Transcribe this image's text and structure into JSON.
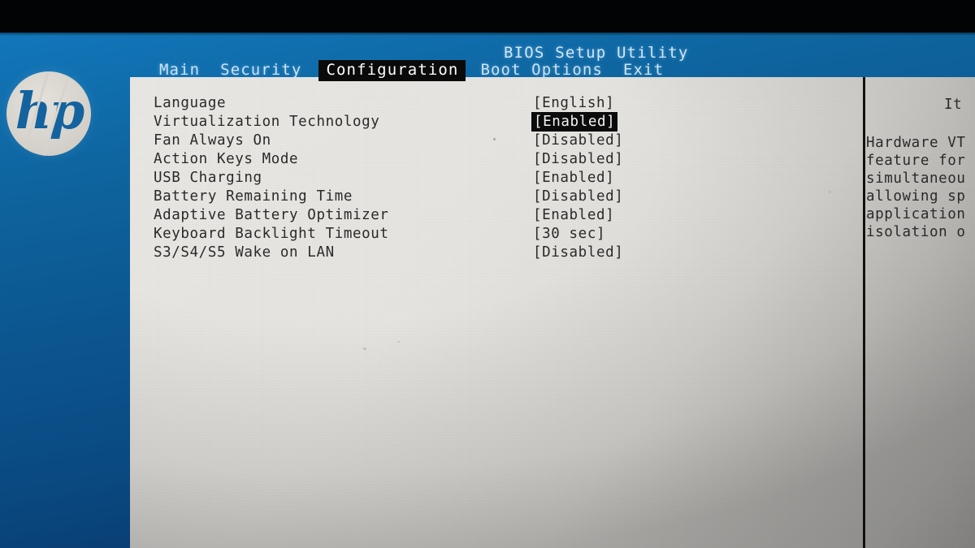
{
  "screen": {
    "utility_title": "BIOS Setup Utility",
    "brand_logo": "hp",
    "accent_blue": "#0c5690",
    "panel_gray": "#e9e7e3",
    "highlight_bg": "#0b0b0b",
    "highlight_fg": "#ffffff"
  },
  "tabs": [
    {
      "label": "Main",
      "active": false
    },
    {
      "label": "Security",
      "active": false
    },
    {
      "label": "Configuration",
      "active": true
    },
    {
      "label": "Boot Options",
      "active": false
    },
    {
      "label": "Exit",
      "active": false
    }
  ],
  "settings": [
    {
      "label": "Language",
      "value": "[English]",
      "selected": false
    },
    {
      "label": "Virtualization Technology",
      "value": "[Enabled]",
      "selected": true
    },
    {
      "label": "Fan Always On",
      "value": "[Disabled]",
      "selected": false
    },
    {
      "label": "Action Keys Mode",
      "value": "[Disabled]",
      "selected": false
    },
    {
      "label": "USB Charging",
      "value": "[Enabled]",
      "selected": false
    },
    {
      "label": "Battery Remaining Time",
      "value": "[Disabled]",
      "selected": false
    },
    {
      "label": "Adaptive Battery Optimizer",
      "value": "[Enabled]",
      "selected": false
    },
    {
      "label": "Keyboard Backlight Timeout",
      "value": "[30 sec]",
      "selected": false
    },
    {
      "label": "S3/S4/S5 Wake on LAN",
      "value": "[Disabled]",
      "selected": false
    }
  ],
  "help": {
    "title": "It",
    "lines": [
      "Hardware VT",
      "feature for",
      "simultaneou",
      "allowing sp",
      "application",
      "isolation o"
    ]
  }
}
